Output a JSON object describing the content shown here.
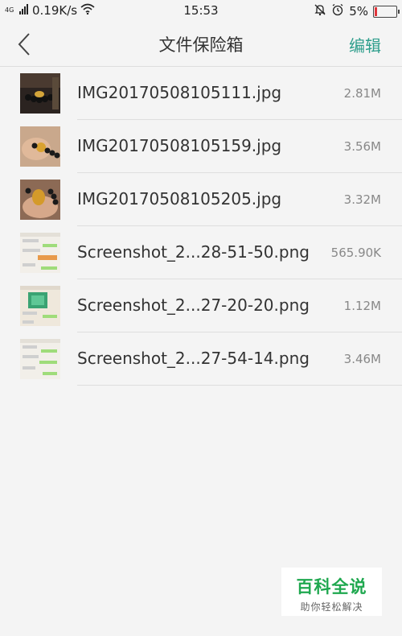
{
  "status_bar": {
    "network_label": "4G",
    "speed": "0.19K/s",
    "time": "15:53",
    "battery_percent": "5%",
    "battery_level": 0.05,
    "battery_color": "#e0353b",
    "icons": [
      "signal-icon",
      "wifi-icon",
      "mute-icon",
      "alarm-icon",
      "battery-icon"
    ]
  },
  "header": {
    "back_icon": "chevron-left-icon",
    "title": "文件保险箱",
    "edit_label": "编辑",
    "accent_color": "#2e9e8c"
  },
  "files": [
    {
      "name": "IMG20170508105111.jpg",
      "size": "2.81M",
      "thumb": "photo-bracelet-1"
    },
    {
      "name": "IMG20170508105159.jpg",
      "size": "3.56M",
      "thumb": "photo-bracelet-2"
    },
    {
      "name": "IMG20170508105205.jpg",
      "size": "3.32M",
      "thumb": "photo-bracelet-3"
    },
    {
      "name": "Screenshot_2...28-51-50.png",
      "size": "565.90K",
      "thumb": "screenshot-chat-1"
    },
    {
      "name": "Screenshot_2...27-20-20.png",
      "size": "1.12M",
      "thumb": "screenshot-chat-2"
    },
    {
      "name": "Screenshot_2...27-54-14.png",
      "size": "3.46M",
      "thumb": "screenshot-chat-3"
    }
  ],
  "watermark": {
    "main": "百科全说",
    "sub": "助你轻松解决"
  }
}
